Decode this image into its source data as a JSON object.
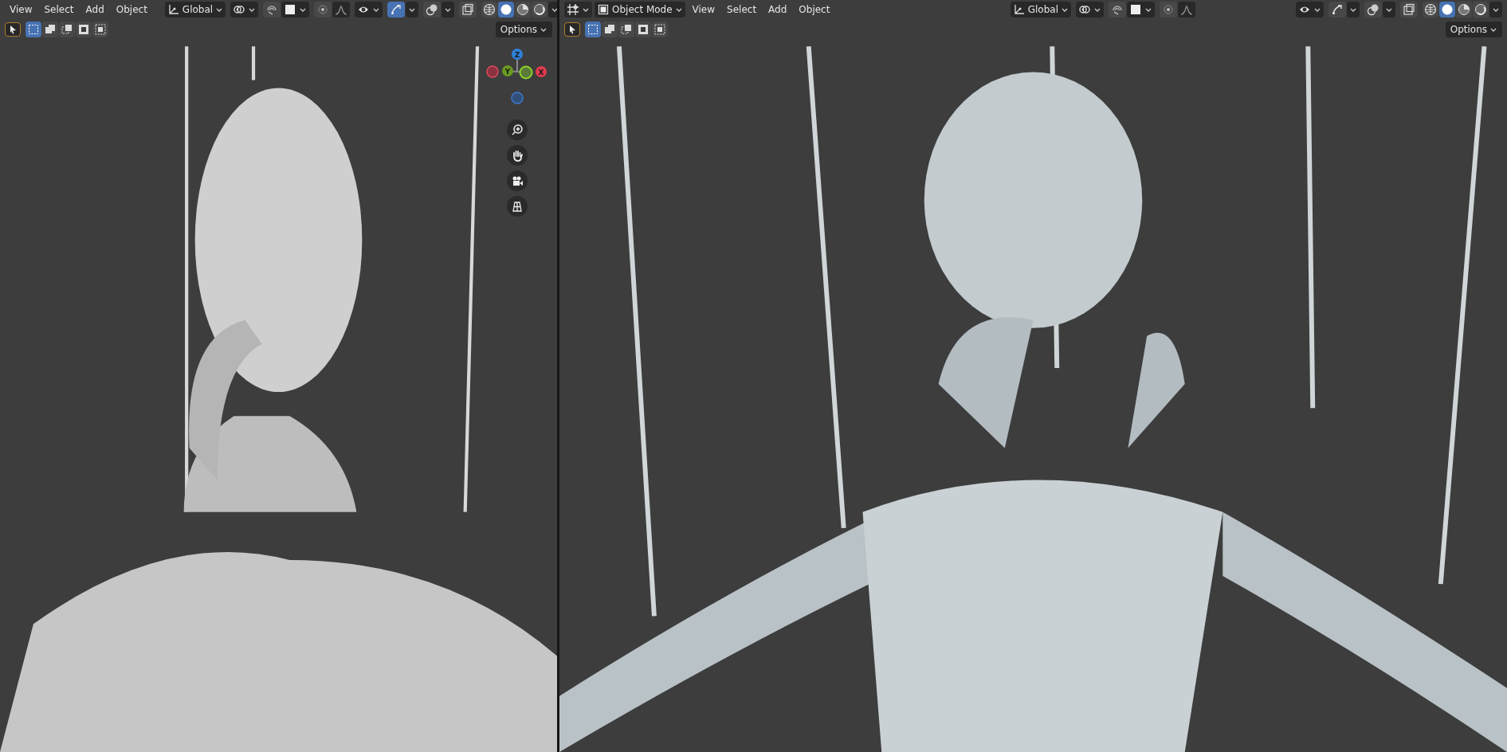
{
  "viewports": [
    {
      "menus": [
        "View",
        "Select",
        "Add",
        "Object"
      ],
      "orientation": "Global",
      "gizmos_on": true,
      "shading": [
        {
          "kind": "wireframe",
          "selected": false
        },
        {
          "kind": "solid",
          "selected": true
        },
        {
          "kind": "material",
          "selected": false
        },
        {
          "kind": "rendered",
          "selected": false
        }
      ],
      "select_modes": [
        {
          "kind": "new",
          "selected": true
        },
        {
          "kind": "extend",
          "selected": false
        },
        {
          "kind": "subtract",
          "selected": false
        },
        {
          "kind": "invert",
          "selected": false
        },
        {
          "kind": "intersect",
          "selected": false
        }
      ],
      "options": "Options",
      "axis_gizmo": {
        "z": "Z",
        "y": "Y",
        "x": "X"
      }
    },
    {
      "mode": "Object Mode",
      "menus": [
        "View",
        "Select",
        "Add",
        "Object"
      ],
      "orientation": "Global",
      "gizmos_on": false,
      "shading": [
        {
          "kind": "wireframe",
          "selected": false
        },
        {
          "kind": "solid",
          "selected": true
        },
        {
          "kind": "material",
          "selected": false
        },
        {
          "kind": "rendered",
          "selected": false
        }
      ],
      "select_modes": [
        {
          "kind": "new",
          "selected": true
        },
        {
          "kind": "extend",
          "selected": false
        },
        {
          "kind": "subtract",
          "selected": false
        },
        {
          "kind": "invert",
          "selected": false
        },
        {
          "kind": "intersect",
          "selected": false
        }
      ],
      "options": "Options"
    }
  ]
}
